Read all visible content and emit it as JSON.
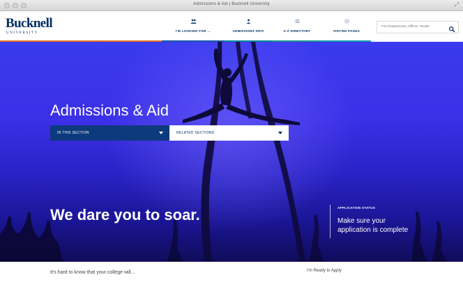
{
  "window": {
    "title": "Admissions & Aid | Bucknell University"
  },
  "logo": {
    "name": "Bucknell",
    "subtitle": "UNIVERSITY"
  },
  "nav": {
    "items": [
      {
        "label": "I'M LOOKING FOR ...",
        "icon": "people-icon"
      },
      {
        "label": "ADMISSIONS INFO",
        "icon": "person-icon"
      },
      {
        "label": "A-Z DIRECTORY",
        "icon": "list-icon"
      },
      {
        "label": "VISITED PAGES",
        "icon": "history-icon"
      }
    ]
  },
  "search": {
    "placeholder": "Find Departments, Offices, People"
  },
  "hero": {
    "title": "Admissions & Aid",
    "dropdowns": {
      "in_section": "IN THIS SECTION",
      "related": "RELATED SECTIONS"
    },
    "tagline": "We dare you to soar.",
    "status": {
      "label": "APPLICATION STATUS",
      "text_line1": "Make sure your",
      "text_line2": "application is complete"
    }
  },
  "below": {
    "intro": "It's hard to know that your college will...",
    "ready": "I'm Ready to Apply"
  },
  "colors": {
    "brand_navy": "#002d62",
    "accent_orange": "#e87722",
    "hero_blue": "#3b2fe8"
  }
}
